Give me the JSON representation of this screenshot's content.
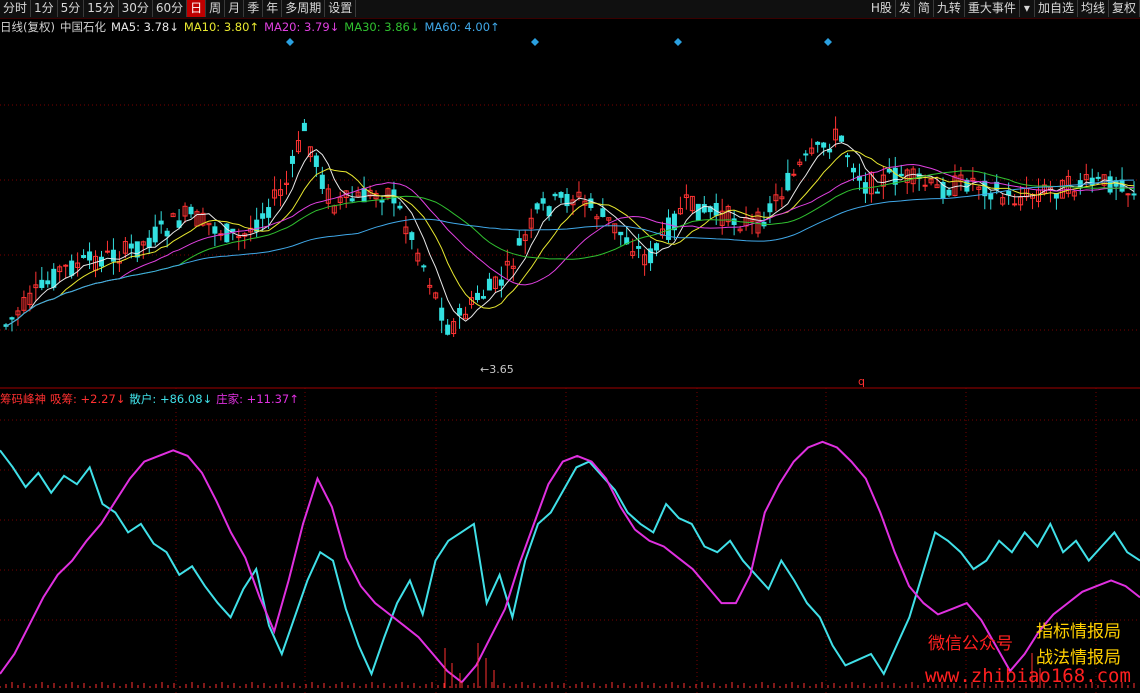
{
  "toolbar": {
    "left_buttons": [
      "分时",
      "1分",
      "5分",
      "15分",
      "30分",
      "60分",
      "日",
      "周",
      "月",
      "季",
      "年",
      "多周期",
      "设置"
    ],
    "active": "日",
    "right_buttons": [
      "H股",
      "发",
      "简",
      "九转",
      "重大事件",
      "▾",
      "加自选",
      "均线",
      "复权"
    ]
  },
  "main_legend": {
    "mode": "日线(复权)",
    "stock": "中国石化",
    "ma5": "MA5: 3.78↓",
    "ma10": "MA10: 3.80↑",
    "ma20": "MA20: 3.79↓",
    "ma30": "MA30: 3.86↓",
    "ma60": "MA60: 4.00↑"
  },
  "sub_legend": {
    "name": "筹码峰神",
    "chip": "吸筹: +2.27↓",
    "retail": "散户: +86.08↓",
    "dealer": "庄家: +11.37↑"
  },
  "low_label": "←3.65",
  "marker_q": "q",
  "watermarks": {
    "wechat": "微信公众号",
    "brand1": "指标情报局",
    "brand2": "战法情报局",
    "url": "www.zhibiao168.com"
  },
  "colors": {
    "up": "#ff3333",
    "down": "#33e0e0",
    "ma5": "#e8e8e8",
    "ma10": "#e8e830",
    "ma20": "#e040e0",
    "ma30": "#30c030",
    "ma60": "#40a8e8",
    "retail": "#40e0e8",
    "dealer": "#e030e0",
    "grid": "#7a0000"
  },
  "chart_data": {
    "type": "candlestick",
    "title": "",
    "low_marker_value": 3.65,
    "retail_series": [
      84,
      78,
      71,
      76,
      69,
      75,
      72,
      78,
      65,
      62,
      55,
      58,
      51,
      48,
      40,
      43,
      36,
      30,
      25,
      35,
      42,
      22,
      12,
      25,
      38,
      48,
      45,
      28,
      15,
      5,
      18,
      30,
      38,
      26,
      45,
      52,
      55,
      58,
      30,
      40,
      25,
      45,
      58,
      62,
      70,
      78,
      80,
      75,
      70,
      62,
      58,
      55,
      65,
      60,
      58,
      50,
      48,
      52,
      45,
      40,
      35,
      45,
      38,
      30,
      25,
      15,
      8,
      10,
      12,
      5,
      15,
      25,
      40,
      55,
      52,
      48,
      42,
      45,
      52,
      48,
      55,
      50,
      58,
      48,
      52,
      45,
      50,
      55,
      48,
      45
    ],
    "dealer_series": [
      5,
      12,
      22,
      32,
      40,
      45,
      52,
      58,
      66,
      74,
      80,
      82,
      84,
      82,
      76,
      66,
      55,
      46,
      32,
      20,
      38,
      58,
      74,
      64,
      46,
      36,
      30,
      26,
      22,
      18,
      12,
      6,
      2,
      8,
      18,
      28,
      44,
      58,
      72,
      80,
      82,
      80,
      74,
      64,
      56,
      52,
      50,
      46,
      42,
      36,
      30,
      30,
      40,
      62,
      72,
      80,
      85,
      87,
      85,
      80,
      74,
      62,
      48,
      36,
      30,
      26,
      28,
      30,
      24,
      15,
      6,
      12,
      20,
      26,
      30,
      34,
      36,
      38,
      36,
      32
    ]
  }
}
